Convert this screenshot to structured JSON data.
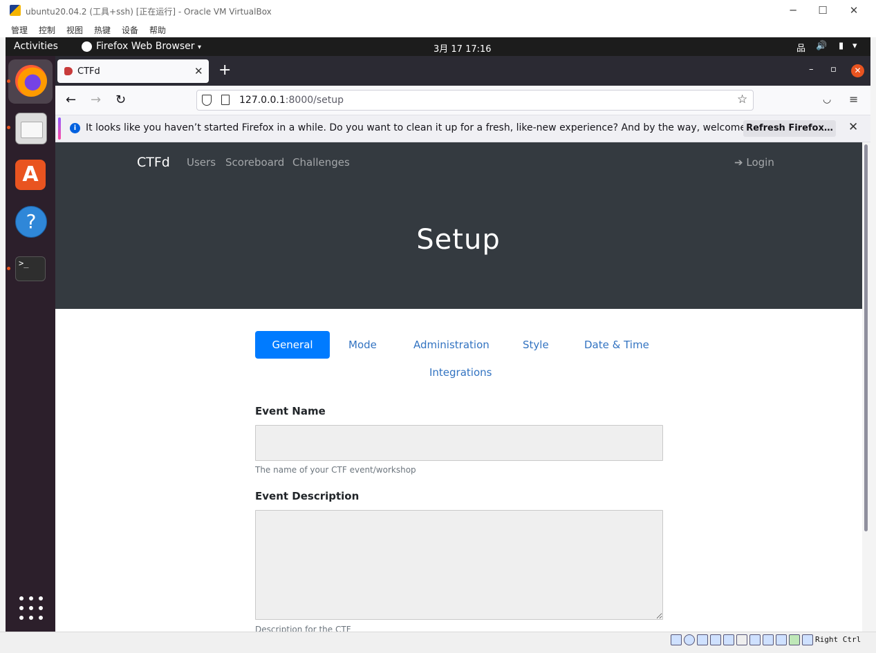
{
  "vbox": {
    "title": "ubuntu20.04.2 (工具+ssh) [正在运行] - Oracle VM VirtualBox",
    "window_controls": {
      "minimize": "─",
      "maximize": "☐",
      "close": "✕"
    },
    "menu": [
      "管理",
      "控制",
      "视图",
      "热键",
      "设备",
      "帮助"
    ],
    "host_key": "Right Ctrl"
  },
  "ubuntu": {
    "activities": "Activities",
    "app_name": "Firefox Web Browser",
    "caret": "▾",
    "clock": "3月 17  17:16",
    "tray": {
      "network": "品",
      "volume": "🔊",
      "battery": "▮",
      "menu_caret": "▾"
    },
    "dock_icons": [
      "firefox-icon",
      "files-icon",
      "software-store-icon",
      "help-icon",
      "terminal-icon",
      "show-apps-icon"
    ],
    "store_glyph": "A",
    "help_glyph": "?",
    "terminal_glyph": ">_"
  },
  "firefox": {
    "tab_title": "CTFd",
    "tab_close": "✕",
    "new_tab": "+",
    "window_controls": {
      "minimize": "–",
      "restore": "▫",
      "close": "✕"
    },
    "nav": {
      "back": "←",
      "forward": "→",
      "reload": "↻"
    },
    "url_host": "127.0.0.1",
    "url_rest": ":8000/setup",
    "star": "☆",
    "pocket": "◡",
    "menu": "≡",
    "notification": {
      "icon": "i",
      "text": "It looks like you haven’t started Firefox in a while. Do you want to clean it up for a fresh, like-new experience? And by the way, welcome back!",
      "button": "Refresh Firefox…",
      "close": "✕"
    }
  },
  "ctfd": {
    "brand": "CTFd",
    "nav": [
      "Users",
      "Scoreboard",
      "Challenges"
    ],
    "login": "Login",
    "login_icon": "➔",
    "page_title": "Setup",
    "tabs": [
      "General",
      "Mode",
      "Administration",
      "Style",
      "Date & Time",
      "Integrations"
    ],
    "active_tab": "General",
    "fields": {
      "event_name": {
        "label": "Event Name",
        "value": "",
        "help": "The name of your CTF event/workshop"
      },
      "event_description": {
        "label": "Event Description",
        "value": "",
        "help": "Description for the CTF"
      }
    },
    "colors": {
      "jumbotron": "#343a40",
      "primary": "#007bff",
      "tab_link": "#3273c1"
    }
  }
}
